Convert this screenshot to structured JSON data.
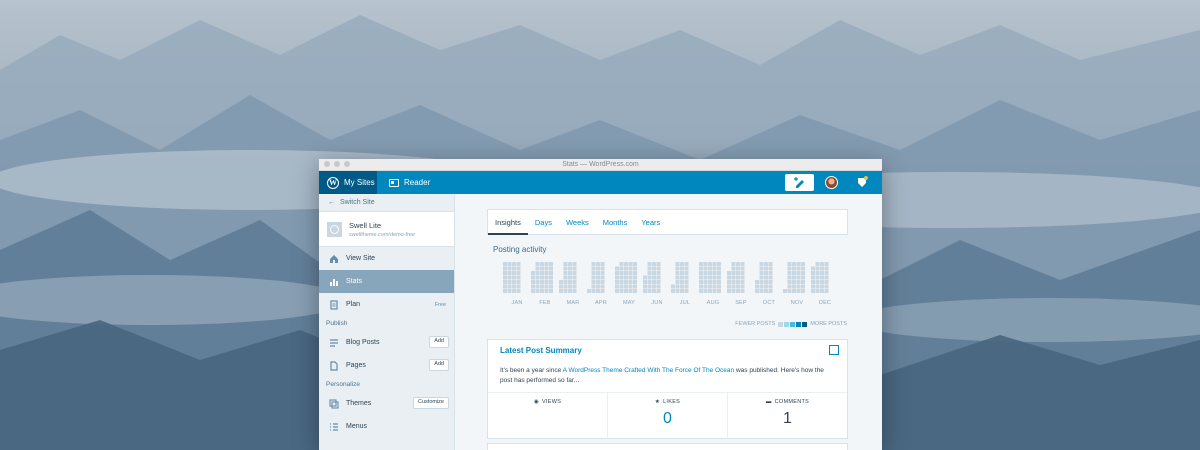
{
  "window": {
    "title": "Stats — WordPress.com"
  },
  "masterbar": {
    "my_sites": "My Sites",
    "reader": "Reader",
    "icons": [
      "wordpress-logo-icon",
      "reader-icon",
      "write-post-icon",
      "avatar",
      "notifications-icon"
    ]
  },
  "sidebar": {
    "switch_site": "Switch Site",
    "site": {
      "name": "Swell Lite",
      "url": "swelltheme.com/demo-free"
    },
    "items": [
      {
        "label": "View Site",
        "icon": "home-icon"
      },
      {
        "label": "Stats",
        "icon": "bar-chart-icon",
        "active": true
      },
      {
        "label": "Plan",
        "icon": "plan-icon",
        "tag": "Free"
      }
    ],
    "publish": {
      "heading": "Publish",
      "items": [
        {
          "label": "Blog Posts",
          "button": "Add"
        },
        {
          "label": "Pages",
          "button": "Add"
        }
      ]
    },
    "personalize": {
      "heading": "Personalize",
      "items": [
        {
          "label": "Themes",
          "button": "Customize"
        },
        {
          "label": "Menus"
        }
      ]
    }
  },
  "tabs": [
    "Insights",
    "Days",
    "Weeks",
    "Months",
    "Years"
  ],
  "posting_activity": {
    "title": "Posting activity",
    "months": [
      "JAN",
      "FEB",
      "MAR",
      "APR",
      "MAY",
      "JUN",
      "JUL",
      "AUG",
      "SEP",
      "OCT",
      "NOV",
      "DEC"
    ],
    "legend_fewer": "FEWER POSTS",
    "legend_more": "MORE POSTS",
    "legend_colors": [
      "#c8d7e1",
      "#9ed6ea",
      "#4ab9e0",
      "#0087be",
      "#005a87"
    ]
  },
  "latest_post": {
    "title": "Latest Post Summary",
    "text_before": "It's been a year since ",
    "link": "A WordPress Theme Crafted With The Force Of The Ocean",
    "text_after": " was published. Here's how the post has performed so far...",
    "stats": [
      {
        "label": "VIEWS",
        "value": "",
        "icon": "eye-icon"
      },
      {
        "label": "LIKES",
        "value": "0",
        "icon": "star-icon"
      },
      {
        "label": "COMMENTS",
        "value": "1",
        "icon": "comment-icon"
      }
    ]
  }
}
